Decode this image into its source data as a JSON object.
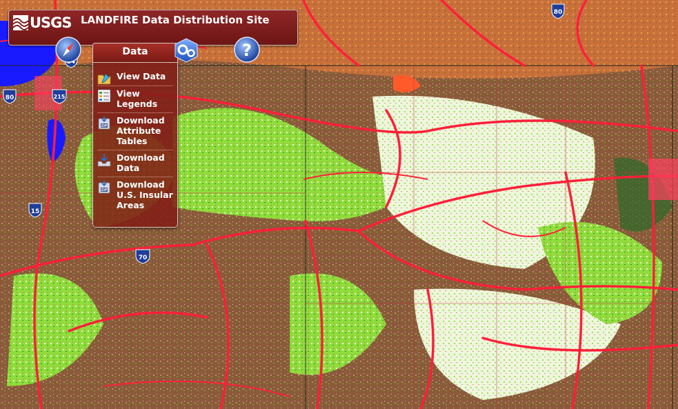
{
  "header": {
    "logo_text": "USGS",
    "title": "LANDFIRE Data Distribution Site"
  },
  "toolbar": {
    "navigation_icon": "compass-icon",
    "tools_icon": "gears-icon",
    "help_icon": "help-icon"
  },
  "data_tab": {
    "label": "Data"
  },
  "data_menu": {
    "items": [
      {
        "label": "View Data",
        "icon": "folder-edit-icon"
      },
      {
        "label": "View Legends",
        "icon": "legend-table-icon"
      },
      {
        "label": "Download Attribute Tables",
        "icon": "zip-download-icon"
      },
      {
        "label": "Download Data",
        "icon": "tray-download-icon"
      },
      {
        "label": "Download U.S. Insular Areas",
        "icon": "zip-download-icon"
      }
    ]
  },
  "map": {
    "shields": [
      {
        "type": "interstate",
        "number": "80"
      },
      {
        "type": "interstate",
        "number": "84"
      },
      {
        "type": "interstate",
        "number": "215"
      },
      {
        "type": "interstate",
        "number": "80"
      },
      {
        "type": "interstate",
        "number": "15"
      },
      {
        "type": "interstate",
        "number": "70"
      }
    ]
  },
  "colors": {
    "banner": "#7e1c1c",
    "roads": "#ff1f3a",
    "water": "#1a1aff"
  }
}
